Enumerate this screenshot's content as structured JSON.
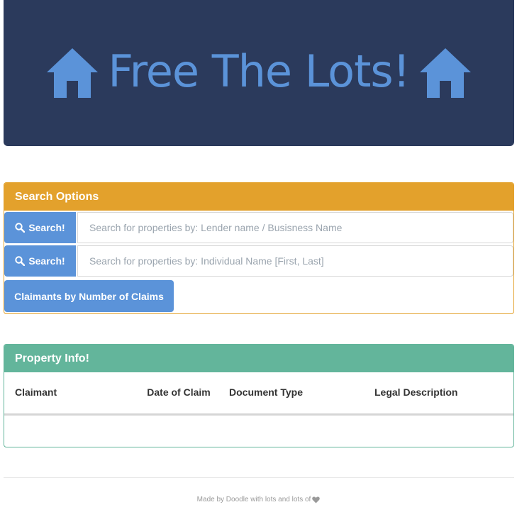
{
  "header": {
    "title": "Free The Lots!",
    "left_icon": "house-icon",
    "right_icon": "house-icon",
    "background_color": "#2b3a5c",
    "title_color": "#5b93d9"
  },
  "search_panel": {
    "heading": "Search Options",
    "heading_color": "#e3a12c",
    "lender_search": {
      "button_label": "Search!",
      "icon": "search-icon",
      "placeholder": "Search for properties by: Lender name / Busisness Name"
    },
    "individual_search": {
      "button_label": "Search!",
      "icon": "search-icon",
      "placeholder": "Search for properties by: Individual Name [First, Last]"
    },
    "claimants_button_label": "Claimants by Number of Claims",
    "button_color": "#5b93d9"
  },
  "property_panel": {
    "heading": "Property Info!",
    "heading_color": "#63b59b",
    "columns": [
      "Claimant",
      "Date of Claim",
      "Document Type",
      "Legal Description"
    ],
    "rows": []
  },
  "footer": {
    "text": "Made by Doodle with lots and lots of",
    "icon": "heart-icon"
  }
}
